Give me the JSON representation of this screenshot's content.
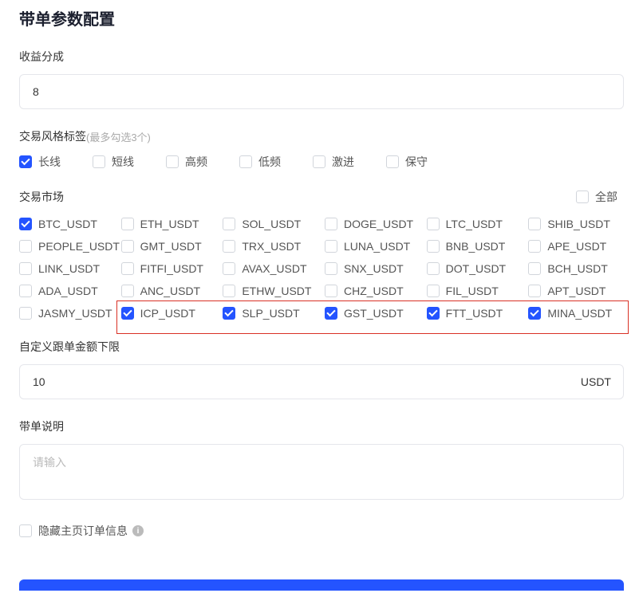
{
  "title": "带单参数配置",
  "profit_share": {
    "label": "收益分成",
    "value": "8"
  },
  "style_tags": {
    "label": "交易风格标签",
    "hint": "(最多勾选3个)",
    "items": [
      {
        "label": "长线",
        "checked": true
      },
      {
        "label": "短线",
        "checked": false
      },
      {
        "label": "高频",
        "checked": false
      },
      {
        "label": "低频",
        "checked": false
      },
      {
        "label": "激进",
        "checked": false
      },
      {
        "label": "保守",
        "checked": false
      }
    ]
  },
  "market": {
    "label": "交易市场",
    "all_label": "全部",
    "all_checked": false,
    "items": [
      {
        "label": "BTC_USDT",
        "checked": true
      },
      {
        "label": "ETH_USDT",
        "checked": false
      },
      {
        "label": "SOL_USDT",
        "checked": false
      },
      {
        "label": "DOGE_USDT",
        "checked": false
      },
      {
        "label": "LTC_USDT",
        "checked": false
      },
      {
        "label": "SHIB_USDT",
        "checked": false
      },
      {
        "label": "PEOPLE_USDT",
        "checked": false
      },
      {
        "label": "GMT_USDT",
        "checked": false
      },
      {
        "label": "TRX_USDT",
        "checked": false
      },
      {
        "label": "LUNA_USDT",
        "checked": false
      },
      {
        "label": "BNB_USDT",
        "checked": false
      },
      {
        "label": "APE_USDT",
        "checked": false
      },
      {
        "label": "LINK_USDT",
        "checked": false
      },
      {
        "label": "FITFI_USDT",
        "checked": false
      },
      {
        "label": "AVAX_USDT",
        "checked": false
      },
      {
        "label": "SNX_USDT",
        "checked": false
      },
      {
        "label": "DOT_USDT",
        "checked": false
      },
      {
        "label": "BCH_USDT",
        "checked": false
      },
      {
        "label": "ADA_USDT",
        "checked": false
      },
      {
        "label": "ANC_USDT",
        "checked": false
      },
      {
        "label": "ETHW_USDT",
        "checked": false
      },
      {
        "label": "CHZ_USDT",
        "checked": false
      },
      {
        "label": "FIL_USDT",
        "checked": false
      },
      {
        "label": "APT_USDT",
        "checked": false
      },
      {
        "label": "JASMY_USDT",
        "checked": false
      },
      {
        "label": "ICP_USDT",
        "checked": true
      },
      {
        "label": "SLP_USDT",
        "checked": true
      },
      {
        "label": "GST_USDT",
        "checked": true
      },
      {
        "label": "FTT_USDT",
        "checked": true
      },
      {
        "label": "MINA_USDT",
        "checked": true
      }
    ]
  },
  "min_follow": {
    "label": "自定义跟单金额下限",
    "value": "10",
    "suffix": "USDT"
  },
  "description": {
    "label": "带单说明",
    "placeholder": "请输入",
    "value": ""
  },
  "hide_order": {
    "label": "隐藏主页订单信息",
    "checked": false
  }
}
